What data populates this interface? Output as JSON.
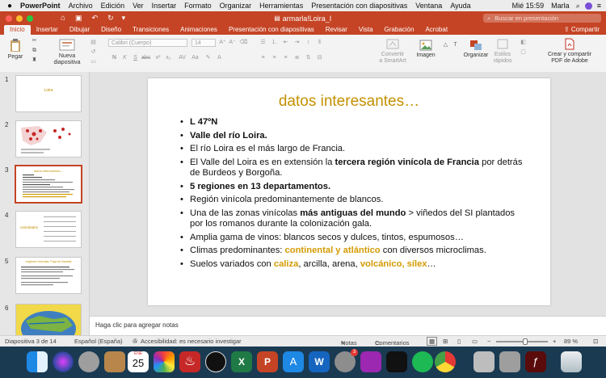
{
  "menubar": {
    "app": "PowerPoint",
    "items": [
      "Archivo",
      "Edición",
      "Ver",
      "Insertar",
      "Formato",
      "Organizar",
      "Herramientas",
      "Presentación con diapositivas",
      "Ventana",
      "Ayuda"
    ],
    "clock": "Mié 15:59",
    "user": "Marla"
  },
  "titlebar": {
    "filename": "armarla!Loira_I",
    "search_placeholder": "Buscar en presentación"
  },
  "ribbon_tabs": [
    "Inicio",
    "Insertar",
    "Dibujar",
    "Diseño",
    "Transiciones",
    "Animaciones",
    "Presentación con diapositivas",
    "Revisar",
    "Vista",
    "Grabación",
    "Acrobat"
  ],
  "share_label": "Compartir",
  "ribbon": {
    "paste": "Pegar",
    "new_slide_1": "Nueva",
    "new_slide_2": "diapositiva",
    "font_name": "Calibri (Cuerpo)",
    "font_size": "14",
    "smartart_1": "Convertir",
    "smartart_2": "a SmartArt",
    "image": "Imagen",
    "arrange": "Organizar",
    "quick_styles_1": "Estilos",
    "quick_styles_2": "rápidos",
    "adobe_1": "Crear y compartir",
    "adobe_2": "PDF de Adobe"
  },
  "thumbnails": [
    {
      "num": "1",
      "text": "Loira"
    },
    {
      "num": "2",
      "text": ""
    },
    {
      "num": "3",
      "text": "datos interesantes..."
    },
    {
      "num": "4",
      "text": "variedades"
    },
    {
      "num": "5",
      "text": "regiones vinícolas: Pays de Nantais"
    },
    {
      "num": "6",
      "text": ""
    }
  ],
  "slide": {
    "title": "datos interesantes…",
    "bullets": [
      [
        {
          "t": "L 47ºN",
          "s": "b"
        }
      ],
      [
        {
          "t": "Valle del río Loira.",
          "s": "b"
        }
      ],
      [
        {
          "t": "El río Loira es el más largo de Francia.",
          "s": ""
        }
      ],
      [
        {
          "t": "El Valle del Loira es en extensión la ",
          "s": ""
        },
        {
          "t": "tercera región vinícola de Francia",
          "s": "b"
        },
        {
          "t": " por detrás de Burdeos y Borgoña.",
          "s": ""
        }
      ],
      [
        {
          "t": "5 regiones en 13 departamentos.",
          "s": "b"
        }
      ],
      [
        {
          "t": "Región vinícola predominantemente de blancos.",
          "s": ""
        }
      ],
      [
        {
          "t": "Una de las zonas vinícolas ",
          "s": ""
        },
        {
          "t": "más antiguas del mundo",
          "s": "b"
        },
        {
          "t": " > viñedos del SI plantados por los romanos durante la colonización gala.",
          "s": ""
        }
      ],
      [
        {
          "t": "Amplia gama de vinos: blancos secos y dulces, tintos, espumosos…",
          "s": ""
        }
      ],
      [
        {
          "t": "Climas predominantes: ",
          "s": ""
        },
        {
          "t": "continental y atlántico",
          "s": "g"
        },
        {
          "t": " con diversos microclimas.",
          "s": ""
        }
      ],
      [
        {
          "t": "Suelos variados con ",
          "s": ""
        },
        {
          "t": "caliza",
          "s": "g"
        },
        {
          "t": ", arcilla, arena, ",
          "s": ""
        },
        {
          "t": "volcánico, sílex",
          "s": "g"
        },
        {
          "t": "…",
          "s": ""
        }
      ]
    ]
  },
  "notes_placeholder": "Haga clic para agregar notas",
  "status": {
    "slide_of": "Diapositiva 3 de 14",
    "language": "Español (España)",
    "accessibility": "Accesibilidad: es necesario investigar",
    "notes": "Notas",
    "comments": "Comentarios",
    "zoom": "89 %"
  },
  "dock": {
    "calendar_month": "ENE",
    "calendar_day": "25",
    "mail_badge": "3"
  },
  "colors": {
    "accent": "#c54425",
    "title_gold": "#c39000",
    "highlight": "#d39a00"
  }
}
